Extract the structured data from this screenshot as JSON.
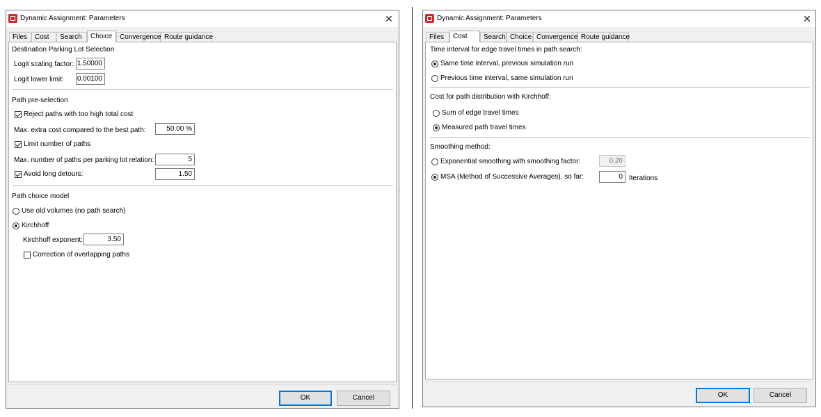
{
  "left": {
    "title": "Dynamic Assignment: Parameters",
    "tabs": [
      "Files",
      "Cost",
      "Search",
      "Choice",
      "Convergence",
      "Route guidance"
    ],
    "active_tab": "Choice",
    "sections": {
      "parking": {
        "heading": "Destination Parking Lot Selection",
        "logit_scaling_label": "Logit scaling factor:",
        "logit_scaling_value": "1.50000",
        "logit_lower_label": "Logit lower limit:",
        "logit_lower_value": "0.00100"
      },
      "preselection": {
        "heading": "Path pre-selection",
        "reject_label": "Reject paths with too high total cost",
        "reject_checked": true,
        "max_extra_label": "Max. extra cost compared to the best path:",
        "max_extra_value": "50.00 %",
        "limit_label": "Limit number of paths",
        "limit_checked": true,
        "max_paths_label": "Max. number of paths per parking lot relation:",
        "max_paths_value": "5",
        "avoid_label": "Avoid long detours:",
        "avoid_checked": true,
        "avoid_value": "1.50"
      },
      "choice_model": {
        "heading": "Path choice model",
        "old_volumes_label": "Use old volumes (no path search)",
        "kirchhoff_label": "Kirchhoff",
        "selected": "Kirchhoff",
        "exponent_label": "Kirchhoff exponent:",
        "exponent_value": "3.50",
        "correction_label": "Correction of overlapping paths",
        "correction_checked": false
      }
    },
    "ok_label": "OK",
    "cancel_label": "Cancel"
  },
  "right": {
    "title": "Dynamic Assignment: Parameters",
    "tabs": [
      "Files",
      "Cost",
      "Search",
      "Choice",
      "Convergence",
      "Route guidance"
    ],
    "active_tab": "Cost",
    "sections": {
      "time_interval": {
        "heading": "Time interval for edge travel times in path search:",
        "opt1": "Same time interval, previous simulation run",
        "opt2": "Previous time interval, same simulation run",
        "selected": "opt1"
      },
      "kirchhoff_cost": {
        "heading": "Cost for path distribution with Kirchhoff:",
        "opt1": "Sum of edge travel times",
        "opt2": "Measured path travel times",
        "selected": "opt2"
      },
      "smoothing": {
        "heading": "Smoothing method:",
        "exp_label": "Exponential smoothing with smoothing factor:",
        "exp_value": "0.20",
        "msa_label": "MSA (Method of Successive Averages), so far:",
        "msa_value": "0",
        "iterations_label": "Iterations",
        "selected": "msa"
      }
    },
    "ok_label": "OK",
    "cancel_label": "Cancel"
  },
  "icons": {
    "app": "app-logo-icon",
    "close": "close-icon"
  },
  "colors": {
    "accent": "#0078d7",
    "app_icon": "#d9262c"
  }
}
